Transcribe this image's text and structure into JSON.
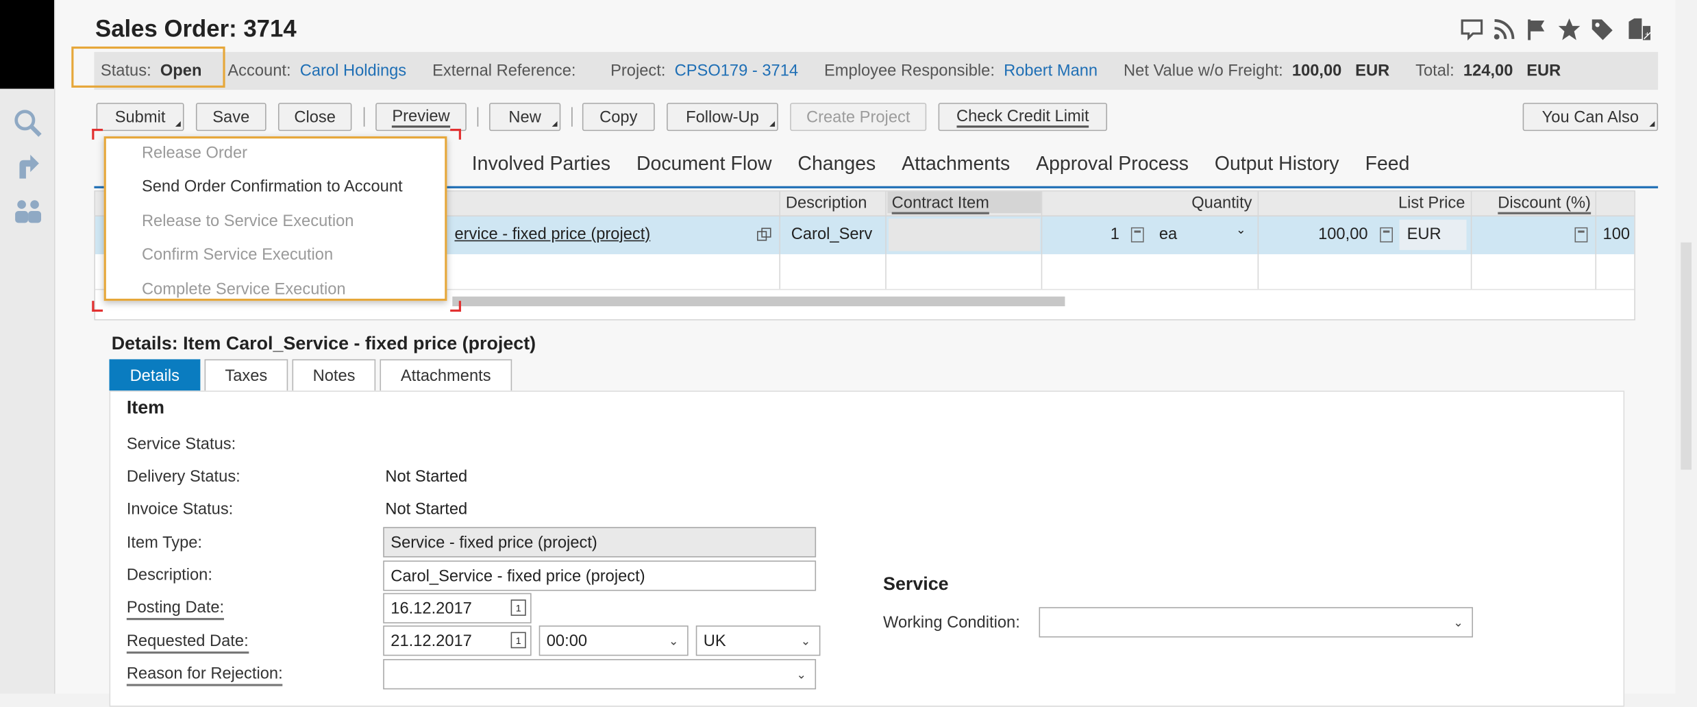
{
  "header": {
    "title": "Sales Order: 3714",
    "icons": [
      "chat-icon",
      "rss-icon",
      "flag-icon",
      "star-icon",
      "tag-icon",
      "new-document-icon"
    ]
  },
  "info_bar": {
    "status_label": "Status:",
    "status_value": "Open",
    "account_label": "Account:",
    "account_value": "Carol Holdings",
    "external_ref_label": "External Reference:",
    "project_label": "Project:",
    "project_value": "CPSO179 - 3714",
    "employee_label": "Employee Responsible:",
    "employee_value": "Robert Mann",
    "net_value_label": "Net Value w/o Freight:",
    "net_value": "100,00",
    "net_currency": "EUR",
    "total_label": "Total:",
    "total_value": "124,00",
    "total_currency": "EUR"
  },
  "toolbar": {
    "submit": "Submit",
    "save": "Save",
    "close": "Close",
    "preview": "Preview",
    "new": "New",
    "copy": "Copy",
    "follow_up": "Follow-Up",
    "create_project": "Create Project",
    "check_credit": "Check Credit Limit",
    "you_can_also": "You Can Also"
  },
  "submit_menu": {
    "items": [
      {
        "label": "Release Order",
        "enabled": false
      },
      {
        "label": "Send Order Confirmation to Account",
        "enabled": true
      },
      {
        "label": "Release to Service Execution",
        "enabled": false
      },
      {
        "label": "Confirm Service Execution",
        "enabled": false
      },
      {
        "label": "Complete Service Execution",
        "enabled": false
      }
    ]
  },
  "tabs": [
    "Involved Parties",
    "Document Flow",
    "Changes",
    "Attachments",
    "Approval Process",
    "Output History",
    "Feed"
  ],
  "items_table": {
    "columns": [
      "Description",
      "Contract Item",
      "Quantity",
      "List Price",
      "Discount (%)"
    ],
    "row": {
      "product": "ervice - fixed price (project)",
      "description": "Carol_Serv",
      "contract_item": "",
      "quantity": "1",
      "unit": "ea",
      "list_price": "100,00",
      "currency": "EUR",
      "discount": "",
      "net": "100"
    }
  },
  "details": {
    "title": "Details: Item Carol_Service - fixed price (project)",
    "tabs": [
      "Details",
      "Taxes",
      "Notes",
      "Attachments"
    ],
    "item_section": "Item",
    "service_status_label": "Service Status:",
    "delivery_status_label": "Delivery Status:",
    "delivery_status": "Not Started",
    "invoice_status_label": "Invoice Status:",
    "invoice_status": "Not Started",
    "item_type_label": "Item Type:",
    "item_type": "Service - fixed price (project)",
    "description_label": "Description:",
    "description": "Carol_Service - fixed price (project)",
    "posting_date_label": "Posting Date:",
    "posting_date": "16.12.2017",
    "requested_date_label": "Requested Date:",
    "requested_date": "21.12.2017",
    "requested_time": "00:00",
    "requested_tz": "UK",
    "rejection_label": "Reason for Rejection:",
    "service_section": "Service",
    "working_condition_label": "Working Condition:"
  }
}
